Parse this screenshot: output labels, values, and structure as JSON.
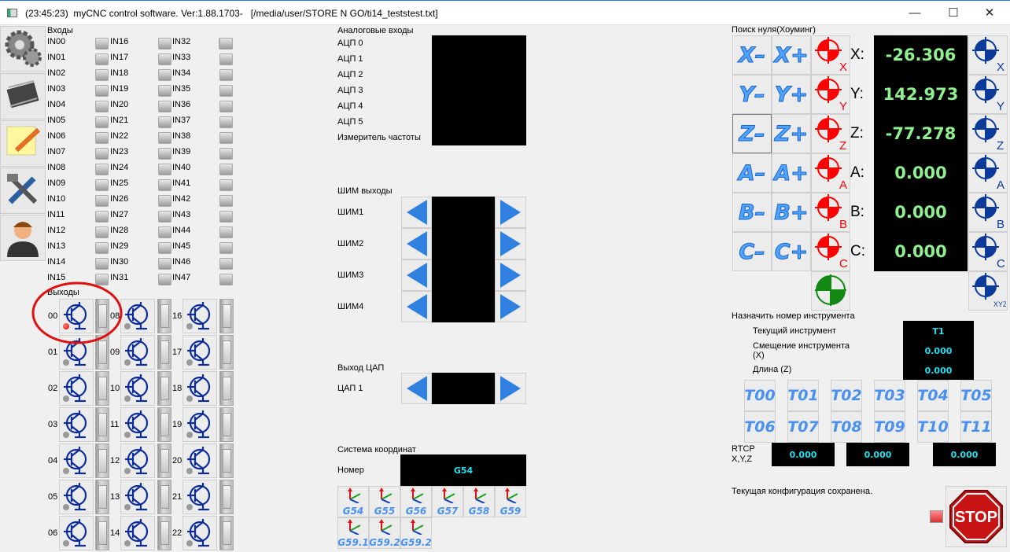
{
  "window": {
    "title": "(23:45:23)  myCNC control software. Ver:1.88.1703-   [/media/user/STORE N GO/ti14_teststest.txt]",
    "minimize": "—",
    "maximize": "☐",
    "close": "✕"
  },
  "sidebar": [
    {
      "icon": "gears-icon"
    },
    {
      "icon": "chip-icon"
    },
    {
      "icon": "note-pencil-icon"
    },
    {
      "icon": "tools-icon"
    },
    {
      "icon": "user-icon"
    }
  ],
  "inputs": {
    "title": "Входы",
    "labels": [
      "IN00",
      "IN01",
      "IN02",
      "IN03",
      "IN04",
      "IN05",
      "IN06",
      "IN07",
      "IN08",
      "IN09",
      "IN10",
      "IN11",
      "IN12",
      "IN13",
      "IN14",
      "IN15",
      "IN16",
      "IN17",
      "IN18",
      "IN19",
      "IN20",
      "IN21",
      "IN22",
      "IN23",
      "IN24",
      "IN25",
      "IN26",
      "IN27",
      "IN28",
      "IN29",
      "IN30",
      "IN31",
      "IN32",
      "IN33",
      "IN34",
      "IN35",
      "IN36",
      "IN37",
      "IN38",
      "IN39",
      "IN40",
      "IN41",
      "IN42",
      "IN43",
      "IN44",
      "IN45",
      "IN46",
      "IN47"
    ]
  },
  "outputs": {
    "title": "Выходы",
    "labels": [
      "00",
      "01",
      "02",
      "03",
      "04",
      "05",
      "06",
      "08",
      "09",
      "10",
      "11",
      "12",
      "13",
      "14",
      "16",
      "17",
      "18",
      "19",
      "20",
      "21",
      "22"
    ],
    "active": [
      "00"
    ]
  },
  "analog": {
    "title": "Аналоговые входы",
    "labels": [
      "АЦП 0",
      "АЦП 1",
      "АЦП 2",
      "АЦП 3",
      "АЦП 4",
      "АЦП 5",
      "Измеритель частоты"
    ]
  },
  "pwm": {
    "title": "ШИМ выходы",
    "labels": [
      "ШИМ1",
      "ШИМ2",
      "ШИМ3",
      "ШИМ4"
    ]
  },
  "dac": {
    "title": "Выход ЦАП",
    "labels": [
      "ЦАП 1"
    ]
  },
  "coords": {
    "title": "Система координат",
    "number_label": "Номер",
    "current": "G54",
    "buttons": [
      "G54",
      "G55",
      "G56",
      "G57",
      "G58",
      "G59",
      "G59.1",
      "G59.2",
      "G59.2"
    ]
  },
  "homing": {
    "title": "Поиск нуля(Хоуминг)",
    "axes": [
      {
        "axis": "X",
        "minus": "X–",
        "plus": "X+",
        "value": "-26.306"
      },
      {
        "axis": "Y",
        "minus": "Y–",
        "plus": "Y+",
        "value": "142.973"
      },
      {
        "axis": "Z",
        "minus": "Z–",
        "plus": "Z+",
        "value": "-77.278"
      },
      {
        "axis": "A",
        "minus": "A–",
        "plus": "A+",
        "value": "0.000"
      },
      {
        "axis": "B",
        "minus": "B–",
        "plus": "B+",
        "value": "0.000"
      },
      {
        "axis": "C",
        "minus": "C–",
        "plus": "C+",
        "value": "0.000"
      }
    ],
    "all_label": "XYZ",
    "colors": {
      "home": "#ff0000",
      "zero": "#0b3a9a",
      "readout": "#8ff08f"
    }
  },
  "tool": {
    "title": "Назначить номер инструмента",
    "current_label": "Текущий инструмент",
    "current": "T1",
    "offset_label": "Смещение инструмента (X)",
    "offset": "0.000",
    "length_label": "Длина (Z)",
    "length": "0.000",
    "buttons": [
      "T00",
      "T01",
      "T02",
      "T03",
      "T04",
      "T05",
      "T06",
      "T07",
      "T08",
      "T09",
      "T10",
      "T11"
    ]
  },
  "rtcp": {
    "label": "RTCP X,Y,Z",
    "values": [
      "0.000",
      "0.000",
      "0.000"
    ]
  },
  "status": "Текущая конфигурация сохранена.",
  "stop_label": "STOP"
}
